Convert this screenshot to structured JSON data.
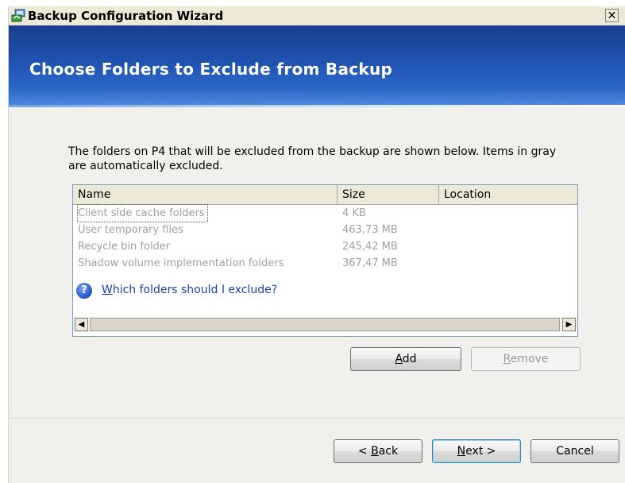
{
  "window": {
    "title": "Backup Configuration Wizard",
    "close_glyph": "✕"
  },
  "header": {
    "heading": "Choose Folders to Exclude from  Backup"
  },
  "description": "The folders on P4 that will be excluded from the backup are shown below. Items in gray are automatically excluded.",
  "list": {
    "columns": [
      "Name",
      "Size",
      "Location"
    ],
    "rows": [
      {
        "name": "Client side cache folders",
        "size": "4 KB",
        "location": ""
      },
      {
        "name": "User temporary files",
        "size": "463,73 MB",
        "location": ""
      },
      {
        "name": "Recycle bin folder",
        "size": "245,42 MB",
        "location": ""
      },
      {
        "name": "Shadow volume implementation folders",
        "size": "367,47 MB",
        "location": ""
      }
    ],
    "scroll_left_glyph": "◀",
    "scroll_right_glyph": "▶"
  },
  "buttons": {
    "add": {
      "prefix": "",
      "accel": "A",
      "rest": "dd"
    },
    "remove": {
      "prefix": "",
      "accel": "R",
      "rest": "emove"
    },
    "back": {
      "prefix": "< ",
      "accel": "B",
      "rest": "ack"
    },
    "next": {
      "prefix": "",
      "accel": "N",
      "rest": "ext >"
    },
    "cancel": {
      "label": "Cancel"
    }
  },
  "help": {
    "icon_glyph": "?",
    "link": {
      "accel": "W",
      "rest": "hich folders should I exclude?"
    }
  },
  "icons": {
    "app": "backup-wizard-icon",
    "help": "help-icon",
    "close": "close-icon"
  },
  "colors": {
    "header_blue": "#1f52b0",
    "excluded_text_gray": "#a0a0a0",
    "link_blue": "#1a3fae"
  }
}
